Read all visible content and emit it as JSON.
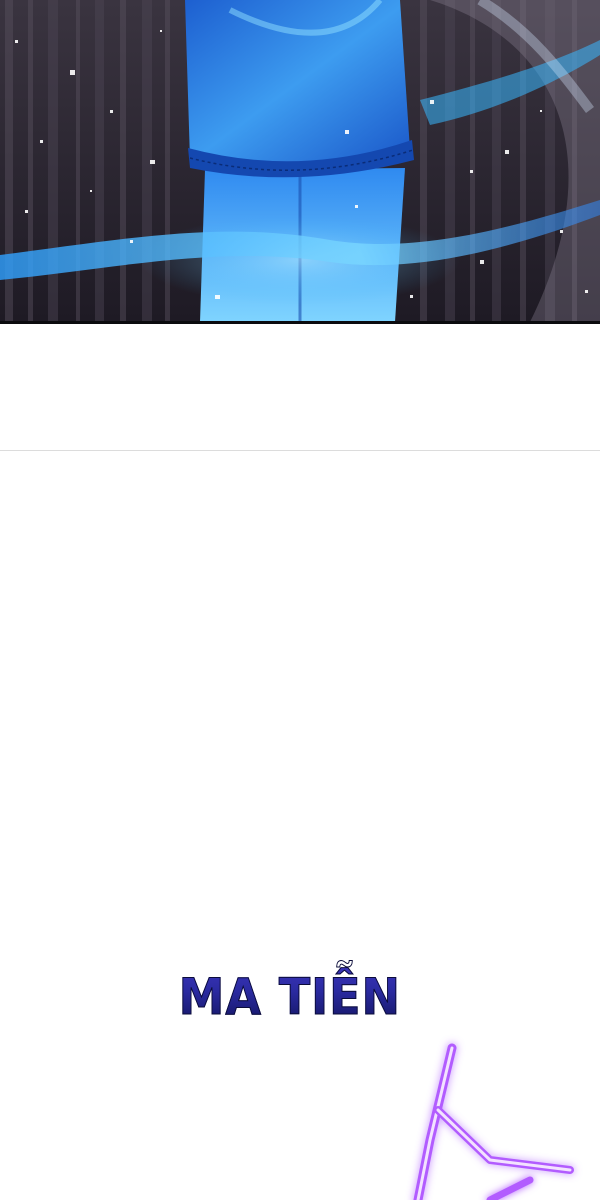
{
  "panels": {
    "top_scene": {
      "description_icon": "glowing-figure-icon",
      "colors": {
        "background_dark": "#2a2530",
        "stripe_light": "#4a4450",
        "figure_blue": "#2f7ee0",
        "figure_highlight": "#7ed2ff",
        "swirl_cyan": "#38b8ff"
      }
    },
    "bottom_scene": {
      "sfx_text": "MA TIỄN",
      "colors": {
        "sfx_top": "#3a34b8",
        "sfx_bottom": "#12145e",
        "effect_purple": "#b25cff"
      }
    }
  }
}
